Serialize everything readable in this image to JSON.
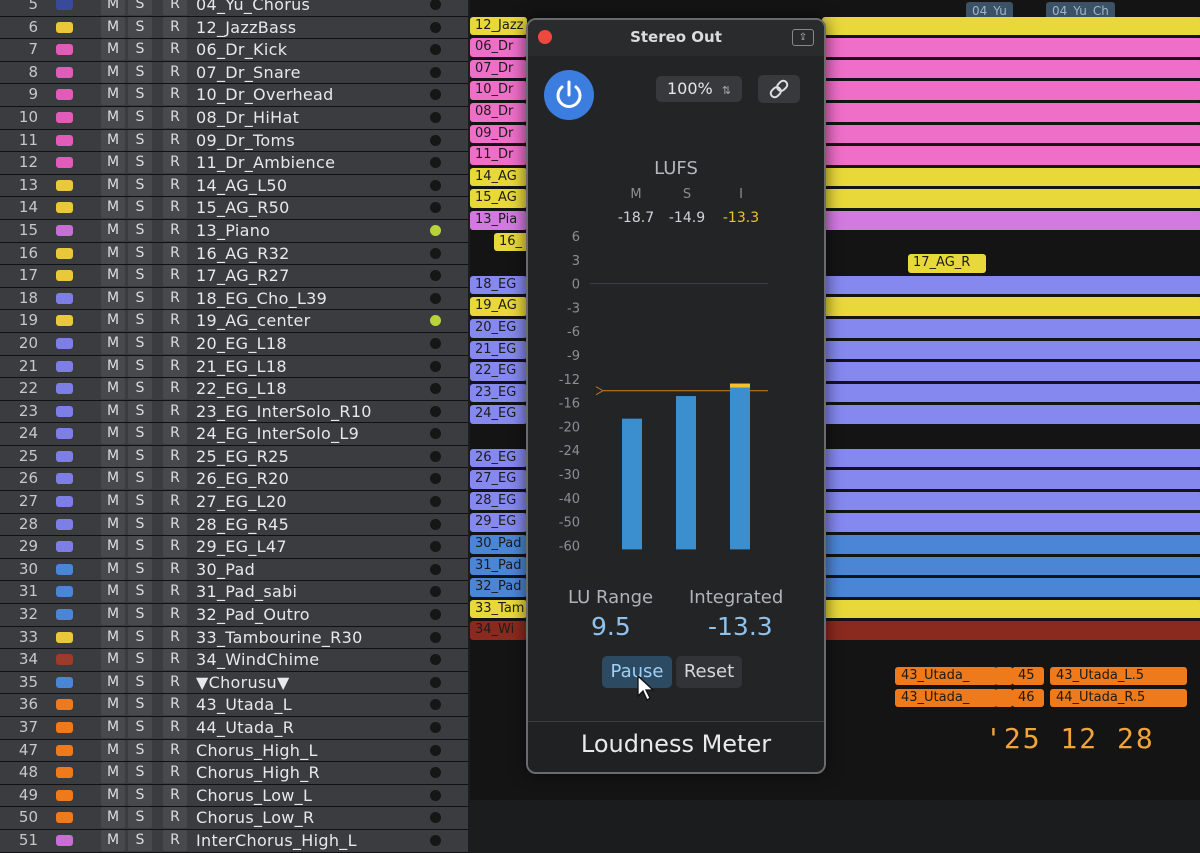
{
  "tracks": [
    {
      "num": "5",
      "name": "04_Yu_Chorus",
      "icon": "#3a4a9a",
      "dot": false
    },
    {
      "num": "6",
      "name": "12_JazzBass",
      "icon": "#e9c83a",
      "dot": false
    },
    {
      "num": "7",
      "name": "06_Dr_Kick",
      "icon": "#e15bb8",
      "dot": false
    },
    {
      "num": "8",
      "name": "07_Dr_Snare",
      "icon": "#e15bb8",
      "dot": false
    },
    {
      "num": "9",
      "name": "10_Dr_Overhead",
      "icon": "#e15bb8",
      "dot": false
    },
    {
      "num": "10",
      "name": "08_Dr_HiHat",
      "icon": "#e15bb8",
      "dot": false
    },
    {
      "num": "11",
      "name": "09_Dr_Toms",
      "icon": "#e15bb8",
      "dot": false
    },
    {
      "num": "12",
      "name": "11_Dr_Ambience",
      "icon": "#e15bb8",
      "dot": false
    },
    {
      "num": "13",
      "name": "14_AG_L50",
      "icon": "#e9c83a",
      "dot": false
    },
    {
      "num": "14",
      "name": "15_AG_R50",
      "icon": "#e9c83a",
      "dot": false
    },
    {
      "num": "15",
      "name": "13_Piano",
      "icon": "#c86fd6",
      "dot": true
    },
    {
      "num": "16",
      "name": "16_AG_R32",
      "icon": "#e9c83a",
      "dot": false
    },
    {
      "num": "17",
      "name": "17_AG_R27",
      "icon": "#e9c83a",
      "dot": false
    },
    {
      "num": "18",
      "name": "18_EG_Cho_L39",
      "icon": "#7d7fe6",
      "dot": false
    },
    {
      "num": "19",
      "name": "19_AG_center",
      "icon": "#e9c83a",
      "dot": true
    },
    {
      "num": "20",
      "name": "20_EG_L18",
      "icon": "#7d7fe6",
      "dot": false
    },
    {
      "num": "21",
      "name": "21_EG_L18",
      "icon": "#7d7fe6",
      "dot": false
    },
    {
      "num": "22",
      "name": "22_EG_L18",
      "icon": "#7d7fe6",
      "dot": false
    },
    {
      "num": "23",
      "name": "23_EG_InterSolo_R10",
      "icon": "#7d7fe6",
      "dot": false
    },
    {
      "num": "24",
      "name": "24_EG_InterSolo_L9",
      "icon": "#7d7fe6",
      "dot": false
    },
    {
      "num": "25",
      "name": "25_EG_R25",
      "icon": "#7d7fe6",
      "dot": false
    },
    {
      "num": "26",
      "name": "26_EG_R20",
      "icon": "#7d7fe6",
      "dot": false
    },
    {
      "num": "27",
      "name": "27_EG_L20",
      "icon": "#7d7fe6",
      "dot": false
    },
    {
      "num": "28",
      "name": "28_EG_R45",
      "icon": "#7d7fe6",
      "dot": false
    },
    {
      "num": "29",
      "name": "29_EG_L47",
      "icon": "#7d7fe6",
      "dot": false
    },
    {
      "num": "30",
      "name": "30_Pad",
      "icon": "#4b86d6",
      "dot": false
    },
    {
      "num": "31",
      "name": "31_Pad_sabi",
      "icon": "#4b86d6",
      "dot": false
    },
    {
      "num": "32",
      "name": "32_Pad_Outro",
      "icon": "#4b86d6",
      "dot": false
    },
    {
      "num": "33",
      "name": "33_Tambourine_R30",
      "icon": "#e9c83a",
      "dot": false
    },
    {
      "num": "34",
      "name": "34_WindChime",
      "icon": "#9a3b2b",
      "dot": false
    },
    {
      "num": "35",
      "name": "▼Chorusu▼",
      "icon": "#4b86d6",
      "dot": false
    },
    {
      "num": "36",
      "name": "43_Utada_L",
      "icon": "#ef7a1b",
      "dot": false
    },
    {
      "num": "37",
      "name": "44_Utada_R",
      "icon": "#ef7a1b",
      "dot": false
    },
    {
      "num": "47",
      "name": "Chorus_High_L",
      "icon": "#ef7a1b",
      "dot": false
    },
    {
      "num": "48",
      "name": "Chorus_High_R",
      "icon": "#ef7a1b",
      "dot": false
    },
    {
      "num": "49",
      "name": "Chorus_Low_L",
      "icon": "#ef7a1b",
      "dot": false
    },
    {
      "num": "50",
      "name": "Chorus_Low_R",
      "icon": "#ef7a1b",
      "dot": false
    },
    {
      "num": "51",
      "name": "InterChorus_High_L",
      "icon": "#c86fd6",
      "dot": false
    }
  ],
  "msr": {
    "m": "M",
    "s": "S",
    "r": "R"
  },
  "markers": [
    "04_Yu",
    "04_Yu_Ch"
  ],
  "regions": [
    {
      "label": "12_Jazz",
      "color": "#e9d83a"
    },
    {
      "label": "06_Dr",
      "color": "#ee6ec8"
    },
    {
      "label": "07_Dr",
      "color": "#ee6ec8"
    },
    {
      "label": "10_Dr",
      "color": "#ee6ec8"
    },
    {
      "label": "08_Dr",
      "color": "#ee6ec8"
    },
    {
      "label": "09_Dr",
      "color": "#ee6ec8"
    },
    {
      "label": "11_Dr",
      "color": "#ee6ec8"
    },
    {
      "label": "14_AG",
      "color": "#e9d83a"
    },
    {
      "label": "15_AG",
      "color": "#e9d83a"
    },
    {
      "label": "13_Pia",
      "color": "#d27ae0"
    },
    {
      "label": "16_",
      "color": "#e9d83a"
    },
    {
      "label": "17_AG_R",
      "color": "#e9d83a"
    },
    {
      "label": "18_EG",
      "color": "#8588ee"
    },
    {
      "label": "19_AG",
      "color": "#e9d83a"
    },
    {
      "label": "20_EG",
      "color": "#8588ee"
    },
    {
      "label": "21_EG",
      "color": "#8588ee"
    },
    {
      "label": "22_EG",
      "color": "#8588ee"
    },
    {
      "label": "23_EG",
      "color": "#8588ee"
    },
    {
      "label": "24_EG",
      "color": "#8588ee"
    },
    {
      "label": "26_EG",
      "color": "#8588ee"
    },
    {
      "label": "27_EG",
      "color": "#8588ee"
    },
    {
      "label": "28_EG",
      "color": "#8588ee"
    },
    {
      "label": "29_EG",
      "color": "#8588ee"
    },
    {
      "label": "30_Pad",
      "color": "#4b86d6"
    },
    {
      "label": "31_Pad",
      "color": "#4b86d6"
    },
    {
      "label": "32_Pad",
      "color": "#4b86d6"
    },
    {
      "label": "33_Tam",
      "color": "#e9d83a"
    },
    {
      "label": "34_Wi",
      "color": "#8a2a1e"
    }
  ],
  "clips": [
    "43_Utada_",
    "45",
    "43_Utada_L.5",
    "43_Utada_",
    "46",
    "44_Utada_R.5"
  ],
  "timecode": "'25 12 28",
  "plugin": {
    "window_title": "Stereo Out",
    "zoom": "100%",
    "lufs_title": "LUFS",
    "m_label": "M",
    "s_label": "S",
    "i_label": "I",
    "m_value": "-18.7",
    "s_value": "-14.9",
    "i_value": "-13.3",
    "scale": [
      "6",
      "3",
      "0",
      "-3",
      "-6",
      "-9",
      "-12",
      "-16",
      "-20",
      "-24",
      "-30",
      "-40",
      "-50",
      "-60"
    ],
    "lu_range_label": "LU Range",
    "lu_range_value": "9.5",
    "integrated_label": "Integrated",
    "integrated_value": "-13.3",
    "pause_label": "Pause",
    "reset_label": "Reset",
    "footer_title": "Loudness Meter",
    "meter_values_lufs": {
      "momentary": -18.7,
      "short_term": -14.9,
      "integrated": -13.3
    },
    "target_lufs": -14
  },
  "colors": {
    "accent": "#3c7de0",
    "meter_bar": "#3b8fcf",
    "integrated": "#f2c12e",
    "target_line": "#b7761e"
  }
}
